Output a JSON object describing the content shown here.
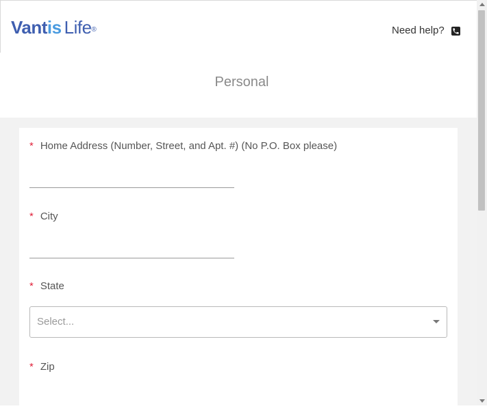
{
  "header": {
    "logo_part1": "Vant",
    "logo_part2": "is",
    "logo_part3": "Life",
    "logo_mark": "®",
    "help_label": "Need help?",
    "help_icon": "phone-icon"
  },
  "page": {
    "title": "Personal"
  },
  "form": {
    "required_marker": "*",
    "home_address_label": "Home Address (Number, Street, and Apt. #) (No P.O. Box please)",
    "home_address_value": "",
    "city_label": "City",
    "city_value": "",
    "state_label": "State",
    "state_placeholder": "Select...",
    "zip_label": "Zip"
  },
  "colors": {
    "brand_dark": "#3f5fb0",
    "brand_light": "#4a9be0",
    "required": "#e0213a"
  }
}
